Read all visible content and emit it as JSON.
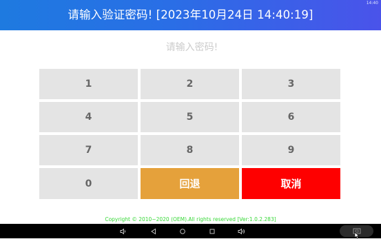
{
  "status_bar": {
    "time": "14:40"
  },
  "header": {
    "title": "请输入验证密码! [2023年10月24日 14:40:19]"
  },
  "password": {
    "placeholder": "请输入密码!",
    "value": ""
  },
  "keypad": {
    "keys": [
      "1",
      "2",
      "3",
      "4",
      "5",
      "6",
      "7",
      "8",
      "9",
      "0"
    ],
    "back_label": "回退",
    "cancel_label": "取消"
  },
  "footer": {
    "copyright": "Copyright © 2010~2020 (OEM).All rights reserved [Ver:1.0.2.283]"
  },
  "navbar": {
    "buttons": [
      "volume-down-icon",
      "back-icon",
      "home-icon",
      "recents-icon",
      "volume-up-icon",
      "screencast-icon"
    ]
  },
  "colors": {
    "header_start": "#1e7ae0",
    "header_end": "#4a53ea",
    "key_bg": "#e4e4e4",
    "key_text": "#666666",
    "back_bg": "#e5a13b",
    "cancel_bg": "#fe0000",
    "footer_text": "#36d836"
  }
}
